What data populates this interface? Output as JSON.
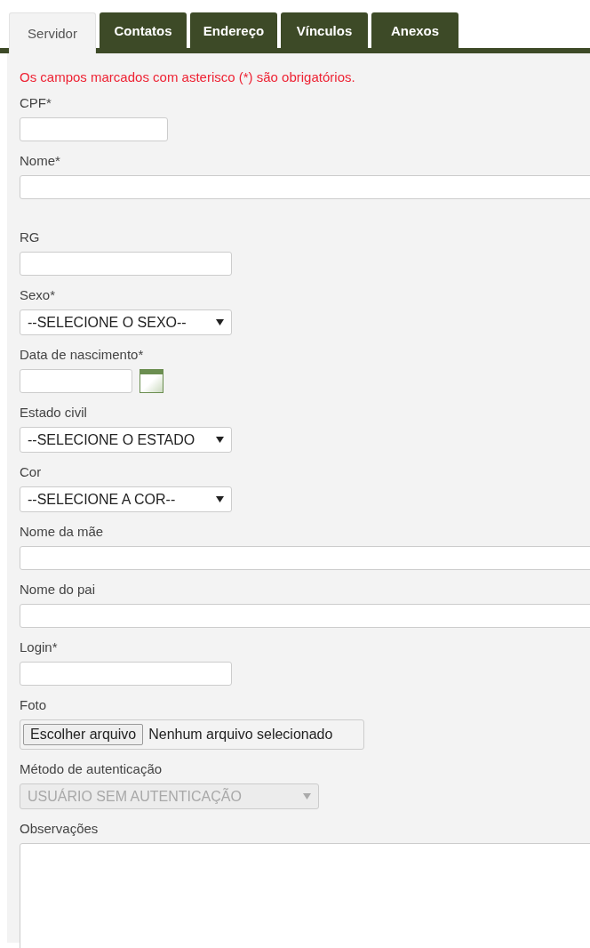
{
  "tabs": [
    {
      "label": "Servidor",
      "selected": true
    },
    {
      "label": "Contatos",
      "selected": false
    },
    {
      "label": "Endereço",
      "selected": false
    },
    {
      "label": "Vínculos",
      "selected": false
    },
    {
      "label": "Anexos",
      "selected": false
    }
  ],
  "notice": "Os campos marcados com asterisco (*) são obrigatórios.",
  "fields": [
    {
      "label": "CPF*",
      "kind": "short-text"
    },
    {
      "label": "Nome*",
      "kind": "long-text"
    },
    {
      "label": "RG",
      "kind": "text"
    },
    {
      "label": "Sexo*",
      "kind": "select",
      "value": "--SELECIONE O SEXO--",
      "disabled": false
    },
    {
      "label": "Data de nascimento*",
      "kind": "date"
    },
    {
      "label": "Estado civil",
      "kind": "select",
      "value": "--SELECIONE O ESTADO",
      "disabled": false
    },
    {
      "label": "Cor",
      "kind": "select",
      "value": "--SELECIONE A COR--",
      "disabled": false
    },
    {
      "label": "Nome da mãe",
      "kind": "long-text"
    },
    {
      "label": "Nome do pai",
      "kind": "long-text"
    },
    {
      "label": "Login*",
      "kind": "text"
    },
    {
      "label": "Foto",
      "kind": "file",
      "button": "Escolher arquivo",
      "status": "Nenhum arquivo selecionado"
    },
    {
      "label": "Método de autenticação",
      "kind": "wide-select",
      "value": "USUÁRIO SEM AUTENTICAÇÃO",
      "disabled": true
    },
    {
      "label": "Observações",
      "kind": "textarea"
    }
  ]
}
